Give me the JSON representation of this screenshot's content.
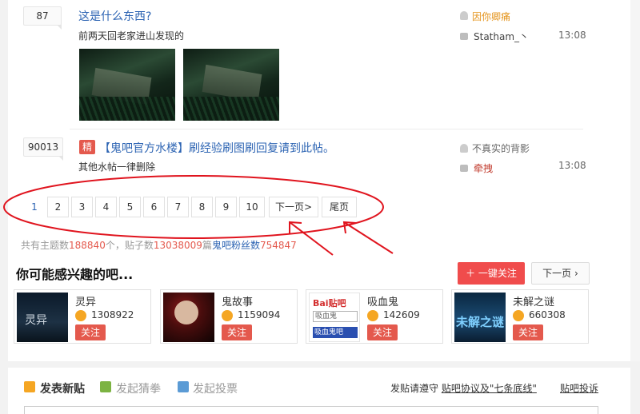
{
  "threads": [
    {
      "reply_count": "87",
      "title": "这是什么东西?",
      "abstract": "前两天回老家进山发现的",
      "author": "因你卿痛",
      "last_reply_user": "Statham_丶",
      "last_reply_time": "13:08",
      "has_images": true,
      "image_count": 2
    },
    {
      "reply_count": "90013",
      "badge": "精",
      "title": "【鬼吧官方水楼】刷经验刷图刷回复请到此帖。",
      "abstract": "其他水帖一律删除",
      "author": "不真实的背影",
      "last_reply_user": "牵拽",
      "last_reply_time": "13:08"
    }
  ],
  "pagination": {
    "current": "1",
    "pages": [
      "2",
      "3",
      "4",
      "5",
      "6",
      "7",
      "8",
      "9",
      "10"
    ],
    "next_label": "下一页>",
    "last_label": "尾页"
  },
  "stats": {
    "prefix": "共有主题数",
    "topics": "188840",
    "mid": "个，贴子数",
    "posts": "13038009",
    "mid2": "篇",
    "members_label": "鬼吧粉丝数",
    "members": "754847"
  },
  "recommend": {
    "title": "你可能感兴趣的吧...",
    "follow_all_label": "一键关注",
    "next_label": "下一页",
    "bars": [
      {
        "name": "灵异",
        "count": "1308922",
        "follow": "关注",
        "logo_text": "灵异"
      },
      {
        "name": "鬼故事",
        "count": "1159094",
        "follow": "关注"
      },
      {
        "name": "吸血鬼",
        "count": "142609",
        "follow": "关注",
        "logo_brand": "Bai贴吧",
        "logo_box": "吸血鬼",
        "logo_bar": "吸血鬼吧"
      },
      {
        "name": "未解之谜",
        "count": "660308",
        "follow": "关注",
        "logo_text": "未解之谜"
      }
    ]
  },
  "post_bar": {
    "tabs": [
      "发表新贴",
      "发起猜拳",
      "发起投票"
    ],
    "notice_prefix": "发贴请遵守",
    "notice_link": "贴吧协议及\"七条底线\"",
    "report": "贴吧投诉"
  },
  "colors": {
    "link_blue": "#2d64b3",
    "accent_red": "#e4594d",
    "annotation_red": "#e0141e"
  }
}
